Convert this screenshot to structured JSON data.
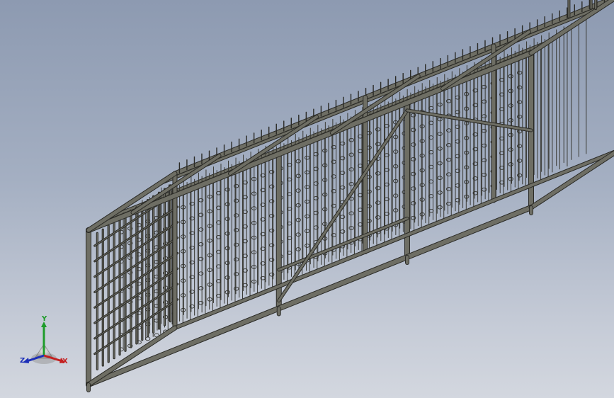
{
  "viewport": {
    "background_top": "#8d9ab1",
    "background_bottom": "#d3d7df",
    "model_color": "#6e6e64",
    "model_edge_color": "#2a2a26"
  },
  "triad": {
    "x_label": "X",
    "y_label": "Y",
    "z_label": "Z",
    "x_color": "#c42020",
    "y_color": "#1e9c2a",
    "z_color": "#1c2fb8"
  }
}
